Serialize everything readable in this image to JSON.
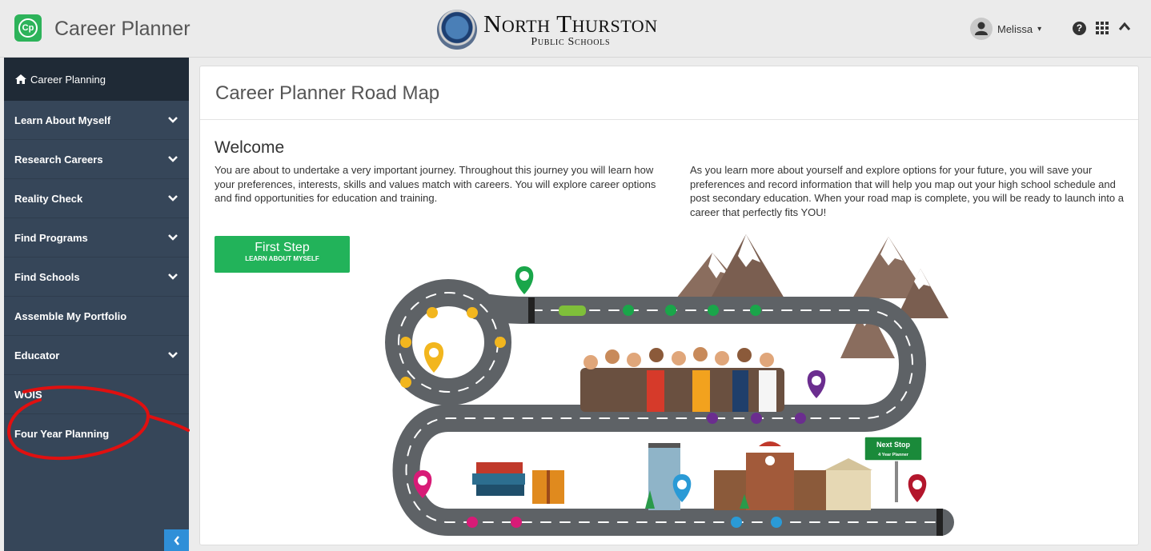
{
  "header": {
    "app_title": "Career Planner",
    "logo_text": "Cp",
    "district_line1": "North Thurston",
    "district_line2": "Public Schools",
    "user_name": "Melissa",
    "user_caret": "▾",
    "help_glyph": "?",
    "collapse_glyph": "^"
  },
  "sidebar": {
    "top_label": "Career Planning",
    "items": [
      {
        "label": "Learn About Myself",
        "has_chevron": true
      },
      {
        "label": "Research Careers",
        "has_chevron": true
      },
      {
        "label": "Reality Check",
        "has_chevron": true
      },
      {
        "label": "Find Programs",
        "has_chevron": true
      },
      {
        "label": "Find Schools",
        "has_chevron": true
      },
      {
        "label": "Assemble My Portfolio",
        "has_chevron": false
      },
      {
        "label": "Educator",
        "has_chevron": true
      },
      {
        "label": "WOIS",
        "has_chevron": false
      },
      {
        "label": "Four Year Planning",
        "has_chevron": false
      }
    ],
    "chevron_glyph": "⌄",
    "collapse_glyph": "<"
  },
  "main": {
    "panel_title": "Career Planner Road Map",
    "welcome_heading": "Welcome",
    "paragraph_left": "You are about to undertake a very important journey. Throughout this journey you will learn how your preferences, interests, skills and values match with careers. You will explore career options and find opportunities for education and training.",
    "paragraph_right": "As you learn more about yourself and explore options for your future, you will save your preferences and record information that will help you map out your high school schedule and post secondary education. When your road map is complete, you will be ready to launch into a career that perfectly fits YOU!",
    "first_step_title": "First Step",
    "first_step_subtitle": "LEARN ABOUT MYSELF",
    "sign_line1": "Next Stop",
    "sign_line2": "4 Year Planner"
  },
  "colors": {
    "brand_green": "#22b35a",
    "sidebar_bg": "#364659",
    "sidebar_top_bg": "#1f2a36",
    "accent_blue": "#2f8fd8",
    "annotation_red": "#e01010",
    "pin_green": "#1aa64a",
    "pin_yellow": "#f2b61e",
    "pin_purple": "#6b2d8f",
    "pin_pink": "#d81b77",
    "pin_blue": "#2a9ad6",
    "pin_red": "#b3162c"
  },
  "icons": [
    "home-icon",
    "chevron-down-icon",
    "user-icon",
    "help-icon",
    "apps-grid-icon",
    "chevron-up-icon",
    "collapse-sidebar-icon",
    "map-pin-icon"
  ]
}
